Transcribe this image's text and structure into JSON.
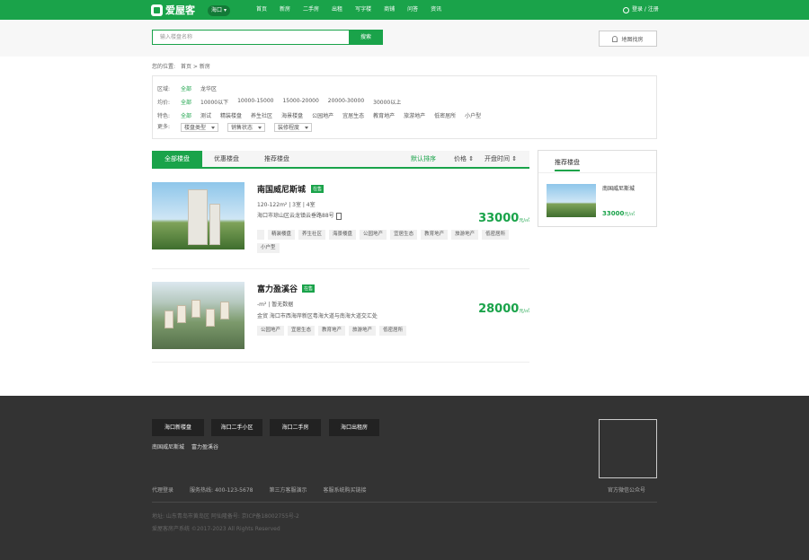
{
  "header": {
    "logo_text": "爱屋客",
    "city": "海口",
    "nav": [
      "首页",
      "新房",
      "二手房",
      "出租",
      "写字楼",
      "商铺",
      "问答",
      "资讯"
    ],
    "login": "登录 / 注册"
  },
  "search": {
    "placeholder": "输入楼盘名称",
    "button": "搜索",
    "map_button": "地图找房"
  },
  "breadcrumb": {
    "label": "您的位置:",
    "home": "首页",
    "sep": ">",
    "current": "新房"
  },
  "filters": {
    "area": {
      "label": "区域:",
      "options": [
        "全部",
        "龙华区"
      ]
    },
    "price": {
      "label": "均价:",
      "options": [
        "全部",
        "10000以下",
        "10000-15000",
        "15000-20000",
        "20000-30000",
        "30000以上"
      ]
    },
    "feature": {
      "label": "特色:",
      "options": [
        "全部",
        "测试",
        "精装楼盘",
        "养生社区",
        "海景楼盘",
        "公园地产",
        "宜居生态",
        "教育地产",
        "旅游地产",
        "低密居所",
        "小户型"
      ]
    },
    "more": {
      "label": "更多:",
      "selects": [
        "楼盘类型",
        "销售状态",
        "装修程度"
      ]
    }
  },
  "tabs": {
    "items": [
      "全部楼盘",
      "优惠楼盘",
      "推荐楼盘"
    ],
    "sorts": [
      "默认排序",
      "价格",
      "开盘时间"
    ]
  },
  "listings": [
    {
      "name": "南国威尼斯城",
      "status": "在售",
      "spec": "120-122m² | 3室 | 4室",
      "address": "海口市琼山区云龙镇云垂路88号",
      "tags": [
        "精装楼盘",
        "养生社区",
        "海景楼盘",
        "公园地产",
        "宜居生态",
        "教育地产",
        "旅游地产",
        "低密居所",
        "小户型"
      ],
      "price": "33000",
      "unit": "元/㎡"
    },
    {
      "name": "富力盈溪谷",
      "status": "在售",
      "spec": "-m² | 暂无数据",
      "address": "金贸 海口市西海岸新区粤海大道与南海大道交汇处",
      "tags": [
        "公园地产",
        "宜居生态",
        "教育地产",
        "旅游地产",
        "低密居所"
      ],
      "price": "28000",
      "unit": "元/㎡"
    }
  ],
  "sidebar": {
    "title": "推荐楼盘",
    "name": "南国威尼斯城",
    "price": "33000",
    "unit": "元/㎡"
  },
  "footer": {
    "buttons": [
      "海口新楼盘",
      "海口二手小区",
      "海口二手房",
      "海口出租房"
    ],
    "links": [
      "南国威尼斯城",
      "富力盈溪谷"
    ],
    "contact": [
      "代理登录",
      "服务热线: 400-123-5678",
      "第三方客服演示",
      "客服系统购买链接"
    ],
    "wechat": "官方微信公众号",
    "address": "地址: 山东青岛市黄岛区 阿仙隆备号: 京ICP备18002755号-2",
    "copyright": "爱屋客房产系统 ©2017-2023 All Rights Reserved"
  }
}
